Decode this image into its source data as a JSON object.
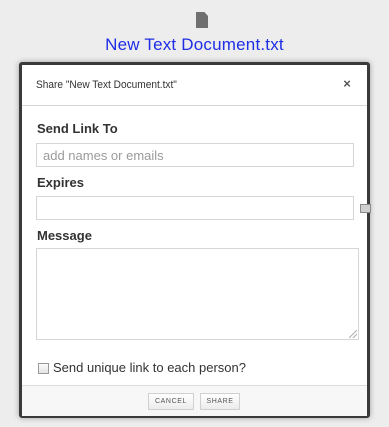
{
  "background": {
    "file_name": "New Text Document.txt",
    "file_icon": "document-icon"
  },
  "dialog": {
    "title": "Share \"New Text Document.txt\"",
    "close_label": "×",
    "send_link": {
      "label": "Send Link To",
      "placeholder": "add names or emails",
      "value": ""
    },
    "expires": {
      "label": "Expires",
      "value": "",
      "icon": "calendar-icon"
    },
    "message": {
      "label": "Message",
      "value": ""
    },
    "unique_link": {
      "label": "Send unique link to each person?",
      "checked": false
    },
    "buttons": {
      "cancel": "CANCEL",
      "share": "SHARE"
    }
  },
  "colors": {
    "link_blue": "#1e2ee6",
    "dialog_border": "#3a3a3a"
  }
}
